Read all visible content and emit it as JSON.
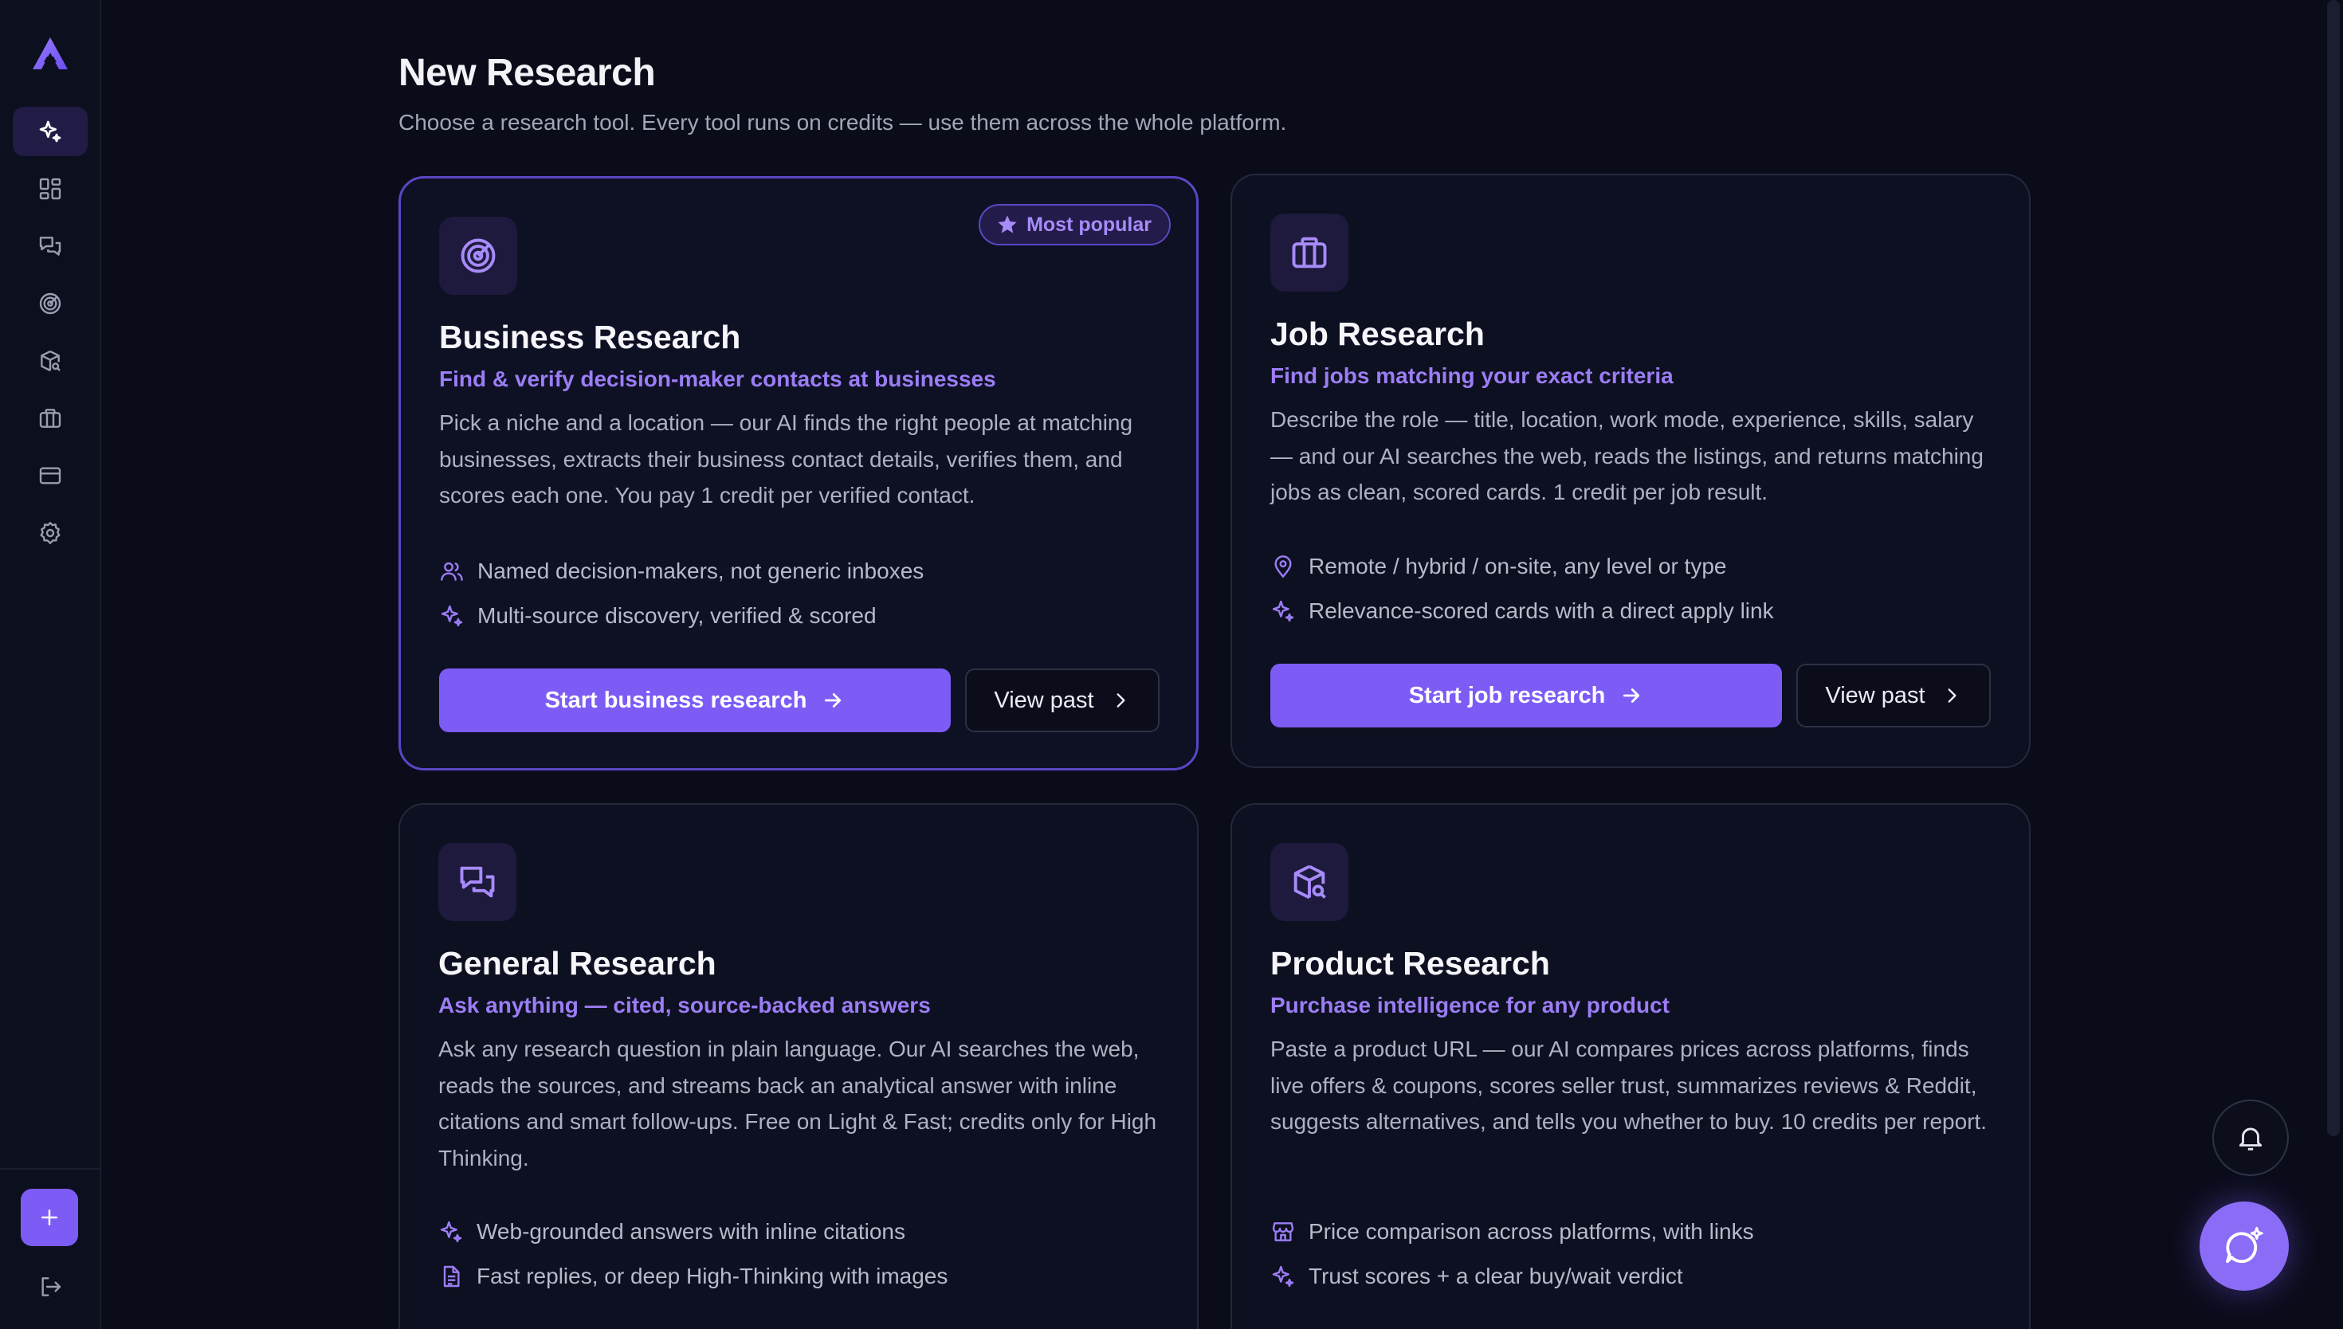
{
  "header": {
    "title": "New Research",
    "subtitle": "Choose a research tool. Every tool runs on credits — use them across the whole platform."
  },
  "sidebar": {
    "items": [
      {
        "icon": "sparkles-icon",
        "active": true
      },
      {
        "icon": "dashboard-icon",
        "active": false
      },
      {
        "icon": "chat-icon",
        "active": false
      },
      {
        "icon": "radar-icon",
        "active": false
      },
      {
        "icon": "package-search-icon",
        "active": false
      },
      {
        "icon": "briefcase-icon",
        "active": false
      },
      {
        "icon": "credit-card-icon",
        "active": false
      },
      {
        "icon": "gear-icon",
        "active": false
      }
    ],
    "add_icon": "plus-icon",
    "logout_icon": "logout-icon"
  },
  "cards": [
    {
      "title": "Business Research",
      "subtitle": "Find & verify decision-maker contacts at businesses",
      "badge": "Most popular",
      "description": "Pick a niche and a location — our AI finds the right people at matching businesses, extracts their business contact details, verifies them, and scores each one. You pay 1 credit per verified contact.",
      "features": [
        "Named decision-makers, not generic inboxes",
        "Multi-source discovery, verified & scored"
      ],
      "primary_label": "Start business research",
      "secondary_label": "View past"
    },
    {
      "title": "Job Research",
      "subtitle": "Find jobs matching your exact criteria",
      "description": "Describe the role — title, location, work mode, experience, skills, salary — and our AI searches the web, reads the listings, and returns matching jobs as clean, scored cards. 1 credit per job result.",
      "features": [
        "Remote / hybrid / on-site, any level or type",
        "Relevance-scored cards with a direct apply link"
      ],
      "primary_label": "Start job research",
      "secondary_label": "View past"
    },
    {
      "title": "General Research",
      "subtitle": "Ask anything — cited, source-backed answers",
      "description": "Ask any research question in plain language. Our AI searches the web, reads the sources, and streams back an analytical answer with inline citations and smart follow-ups. Free on Light & Fast; credits only for High Thinking.",
      "features": [
        "Web-grounded answers with inline citations",
        "Fast replies, or deep High-Thinking with images"
      ]
    },
    {
      "title": "Product Research",
      "subtitle": "Purchase intelligence for any product",
      "description": "Paste a product URL — our AI compares prices across platforms, finds live offers & coupons, scores seller trust, summarizes reviews & Reddit, suggests alternatives, and tells you whether to buy. 10 credits per report.",
      "features": [
        "Price comparison across platforms, with links",
        "Trust scores + a clear buy/wait verdict"
      ]
    }
  ],
  "colors": {
    "accent": "#7c5cf5",
    "accent_text": "#9c7df5",
    "background": "#0a0c1a",
    "card_border": "#24283c"
  }
}
